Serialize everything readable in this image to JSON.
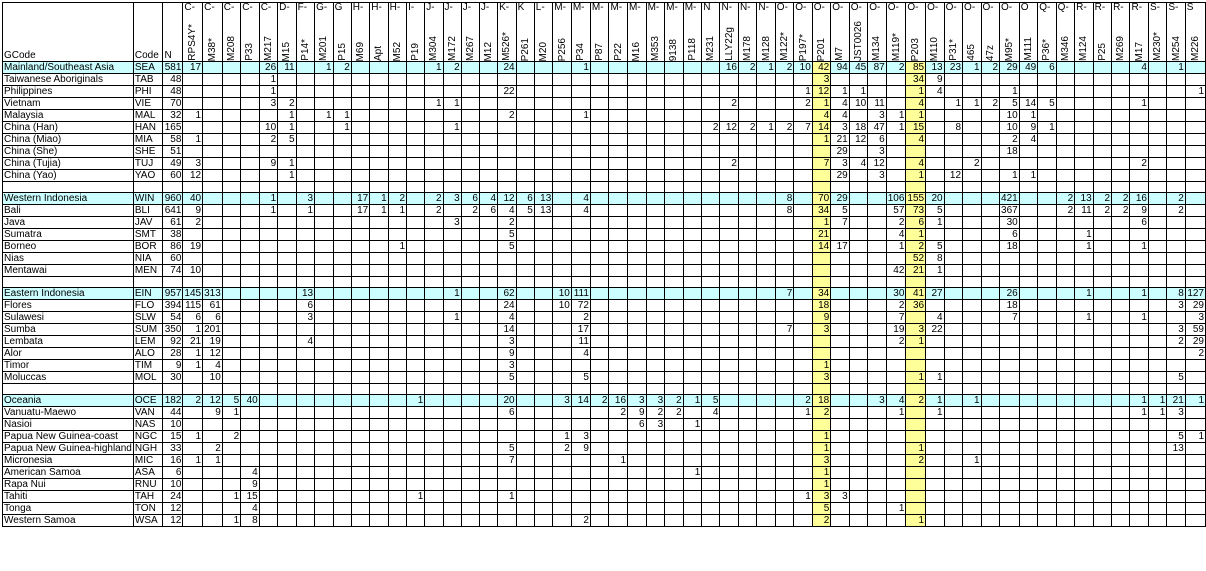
{
  "headers": {
    "gcode": "GCode",
    "code": "Code",
    "n": "N"
  },
  "columns": [
    {
      "hap": "C-",
      "marker": "RPS4Y*"
    },
    {
      "hap": "C-",
      "marker": "M38*"
    },
    {
      "hap": "C-",
      "marker": "M208"
    },
    {
      "hap": "C-",
      "marker": "P33"
    },
    {
      "hap": "C-",
      "marker": "M217"
    },
    {
      "hap": "D-",
      "marker": "M15"
    },
    {
      "hap": "F-",
      "marker": "P14*"
    },
    {
      "hap": "G-",
      "marker": "M201"
    },
    {
      "hap": "G",
      "marker": "P15"
    },
    {
      "hap": "H-",
      "marker": "M69"
    },
    {
      "hap": "H-",
      "marker": "Apt"
    },
    {
      "hap": "H-",
      "marker": "M52"
    },
    {
      "hap": "I-",
      "marker": "P19"
    },
    {
      "hap": "J-",
      "marker": "M304"
    },
    {
      "hap": "J-",
      "marker": "M172"
    },
    {
      "hap": "J-",
      "marker": "M267"
    },
    {
      "hap": "J-",
      "marker": "M12"
    },
    {
      "hap": "K-",
      "marker": "M526*"
    },
    {
      "hap": "K",
      "marker": "P261"
    },
    {
      "hap": "L-",
      "marker": "M20"
    },
    {
      "hap": "M-",
      "marker": "P256"
    },
    {
      "hap": "M-",
      "marker": "P34"
    },
    {
      "hap": "M-",
      "marker": "P87"
    },
    {
      "hap": "M-",
      "marker": "P22"
    },
    {
      "hap": "M-",
      "marker": "M16"
    },
    {
      "hap": "M-",
      "marker": "M353"
    },
    {
      "hap": "M-",
      "marker": "9138"
    },
    {
      "hap": "M-",
      "marker": "P118"
    },
    {
      "hap": "N",
      "marker": "M231"
    },
    {
      "hap": "N-",
      "marker": "LLY22g"
    },
    {
      "hap": "N-",
      "marker": "M178"
    },
    {
      "hap": "N-",
      "marker": "M128"
    },
    {
      "hap": "O-",
      "marker": "M122*"
    },
    {
      "hap": "O-",
      "marker": "P197*"
    },
    {
      "hap": "O-",
      "marker": "P201"
    },
    {
      "hap": "O-",
      "marker": "M7"
    },
    {
      "hap": "O-",
      "marker": "JST0026"
    },
    {
      "hap": "O-",
      "marker": "M134"
    },
    {
      "hap": "O-",
      "marker": "M119*"
    },
    {
      "hap": "O-",
      "marker": "P203"
    },
    {
      "hap": "O-",
      "marker": "M110"
    },
    {
      "hap": "O-",
      "marker": "P31*"
    },
    {
      "hap": "O-",
      "marker": "465"
    },
    {
      "hap": "O-",
      "marker": "47z"
    },
    {
      "hap": "O-",
      "marker": "M95*"
    },
    {
      "hap": "O",
      "marker": "M111"
    },
    {
      "hap": "Q-",
      "marker": "P36*"
    },
    {
      "hap": "Q-",
      "marker": "M346"
    },
    {
      "hap": "R-",
      "marker": "M124"
    },
    {
      "hap": "R-",
      "marker": "P25"
    },
    {
      "hap": "R-",
      "marker": "M269"
    },
    {
      "hap": "R-",
      "marker": "M17"
    },
    {
      "hap": "S-",
      "marker": "M230*"
    },
    {
      "hap": "S-",
      "marker": "M254"
    },
    {
      "hap": "S",
      "marker": "M226"
    }
  ],
  "rows": [
    {
      "t": "sum",
      "g": "Mainland/Southeast Asia",
      "c": "SEA",
      "n": "581",
      "v": {
        "0": "17",
        "4": "26",
        "5": "11",
        "7": "1",
        "8": "2",
        "13": "1",
        "14": "2",
        "17": "24",
        "21": "1",
        "29": "16",
        "30": "2",
        "31": "1",
        "32": "2",
        "33": "10",
        "34": "42",
        "35": "94",
        "36": "45",
        "37": "87",
        "38": "2",
        "39": "85",
        "40": "13",
        "41": "23",
        "42": "1",
        "43": "2",
        "44": "29",
        "45": "49",
        "46": "6",
        "51": "4",
        "53": "1"
      }
    },
    {
      "t": "r",
      "g": "Taiwanese Aboriginals",
      "c": "TAB",
      "n": "48",
      "v": {
        "4": "1",
        "34": "3",
        "39": "34",
        "40": "9"
      }
    },
    {
      "t": "r",
      "g": "Philippines",
      "c": "PHI",
      "n": "48",
      "v": {
        "4": "1",
        "17": "22",
        "33": "1",
        "34": "12",
        "35": "1",
        "36": "1",
        "39": "1",
        "40": "4",
        "44": "1",
        "54": "1"
      }
    },
    {
      "t": "r",
      "g": "Vietnam",
      "c": "VIE",
      "n": "70",
      "v": {
        "4": "3",
        "5": "2",
        "13": "1",
        "14": "1",
        "29": "2",
        "33": "2",
        "34": "1",
        "35": "4",
        "36": "10",
        "37": "11",
        "39": "4",
        "41": "1",
        "42": "1",
        "43": "2",
        "44": "5",
        "45": "14",
        "46": "5",
        "51": "1"
      }
    },
    {
      "t": "r",
      "g": "Malaysia",
      "c": "MAL",
      "n": "32",
      "v": {
        "0": "1",
        "5": "1",
        "7": "1",
        "8": "1",
        "17": "2",
        "21": "1",
        "34": "4",
        "35": "4",
        "37": "3",
        "38": "1",
        "39": "1",
        "44": "10",
        "45": "1"
      }
    },
    {
      "t": "r",
      "g": "China (Han)",
      "c": "HAN",
      "n": "165",
      "v": {
        "4": "10",
        "5": "1",
        "8": "1",
        "14": "1",
        "28": "2",
        "29": "12",
        "30": "2",
        "31": "1",
        "32": "2",
        "33": "7",
        "34": "14",
        "35": "3",
        "36": "18",
        "37": "47",
        "38": "1",
        "39": "15",
        "41": "8",
        "44": "10",
        "45": "9",
        "46": "1"
      }
    },
    {
      "t": "r",
      "g": "China (Miao)",
      "c": "MIA",
      "n": "58",
      "v": {
        "0": "1",
        "4": "2",
        "5": "5",
        "34": "1",
        "35": "21",
        "36": "12",
        "37": "6",
        "39": "4",
        "44": "2",
        "45": "4"
      }
    },
    {
      "t": "r",
      "g": "China (She)",
      "c": "SHE",
      "n": "51",
      "v": {
        "35": "29",
        "37": "3",
        "44": "18"
      }
    },
    {
      "t": "r",
      "g": "China (Tujia)",
      "c": "TUJ",
      "n": "49",
      "v": {
        "0": "3",
        "4": "9",
        "5": "1",
        "29": "2",
        "34": "7",
        "35": "3",
        "36": "4",
        "37": "12",
        "39": "4",
        "42": "2",
        "51": "2"
      }
    },
    {
      "t": "r",
      "g": "China (Yao)",
      "c": "YAO",
      "n": "60",
      "v": {
        "0": "12",
        "5": "1",
        "35": "29",
        "37": "3",
        "39": "1",
        "41": "12",
        "44": "1",
        "45": "1"
      }
    },
    {
      "t": "gap"
    },
    {
      "t": "sum",
      "g": "Western Indonesia",
      "c": "WIN",
      "n": "960",
      "v": {
        "0": "40",
        "4": "1",
        "6": "3",
        "9": "17",
        "10": "1",
        "11": "2",
        "13": "2",
        "14": "3",
        "15": "6",
        "16": "4",
        "17": "12",
        "18": "6",
        "19": "13",
        "21": "4",
        "32": "8",
        "34": "70",
        "35": "29",
        "38": "106",
        "39": "155",
        "40": "20",
        "44": "421",
        "47": "2",
        "48": "13",
        "49": "2",
        "50": "2",
        "51": "16",
        "53": "2"
      }
    },
    {
      "t": "r",
      "g": "Bali",
      "c": "BLI",
      "n": "641",
      "v": {
        "0": "9",
        "4": "1",
        "6": "1",
        "9": "17",
        "10": "1",
        "11": "1",
        "13": "2",
        "15": "2",
        "16": "6",
        "17": "4",
        "18": "5",
        "19": "13",
        "21": "4",
        "32": "8",
        "34": "34",
        "35": "5",
        "38": "57",
        "39": "73",
        "40": "5",
        "44": "367",
        "47": "2",
        "48": "11",
        "49": "2",
        "50": "2",
        "51": "9",
        "53": "2"
      }
    },
    {
      "t": "r",
      "g": "Java",
      "c": "JAV",
      "n": "61",
      "v": {
        "0": "2",
        "14": "3",
        "17": "2",
        "34": "1",
        "35": "7",
        "38": "2",
        "39": "6",
        "40": "1",
        "44": "30",
        "51": "6"
      }
    },
    {
      "t": "r",
      "g": "Sumatra",
      "c": "SMT",
      "n": "38",
      "v": {
        "17": "5",
        "34": "21",
        "38": "4",
        "39": "1",
        "44": "6",
        "48": "1"
      }
    },
    {
      "t": "r",
      "g": "Borneo",
      "c": "BOR",
      "n": "86",
      "v": {
        "0": "19",
        "11": "1",
        "17": "5",
        "34": "14",
        "35": "17",
        "38": "1",
        "39": "2",
        "40": "5",
        "44": "18",
        "48": "1",
        "51": "1"
      }
    },
    {
      "t": "r",
      "g": "Nias",
      "c": "NIA",
      "n": "60",
      "v": {
        "39": "52",
        "40": "8"
      }
    },
    {
      "t": "r",
      "g": "Mentawai",
      "c": "MEN",
      "n": "74",
      "v": {
        "0": "10",
        "38": "42",
        "39": "21",
        "40": "1"
      }
    },
    {
      "t": "gap"
    },
    {
      "t": "sum",
      "g": "Eastern Indonesia",
      "c": "EIN",
      "n": "957",
      "v": {
        "0": "145",
        "1": "313",
        "6": "13",
        "14": "1",
        "17": "62",
        "20": "10",
        "21": "111",
        "32": "7",
        "34": "34",
        "38": "30",
        "39": "41",
        "40": "27",
        "44": "26",
        "48": "1",
        "51": "1",
        "53": "8",
        "54": "127"
      }
    },
    {
      "t": "r",
      "g": "Flores",
      "c": "FLO",
      "n": "394",
      "v": {
        "0": "115",
        "1": "61",
        "6": "6",
        "17": "24",
        "20": "10",
        "21": "72",
        "34": "18",
        "38": "2",
        "39": "36",
        "44": "18",
        "53": "3",
        "54": "29"
      }
    },
    {
      "t": "r",
      "g": "Sulawesi",
      "c": "SLW",
      "n": "54",
      "v": {
        "0": "6",
        "1": "6",
        "6": "3",
        "14": "1",
        "17": "4",
        "21": "2",
        "34": "9",
        "38": "7",
        "40": "4",
        "44": "7",
        "48": "1",
        "51": "1",
        "54": "3"
      }
    },
    {
      "t": "r",
      "g": "Sumba",
      "c": "SUM",
      "n": "350",
      "v": {
        "0": "1",
        "1": "201",
        "17": "14",
        "21": "17",
        "32": "7",
        "34": "3",
        "38": "19",
        "39": "3",
        "40": "22",
        "53": "3",
        "54": "59"
      }
    },
    {
      "t": "r",
      "g": "Lembata",
      "c": "LEM",
      "n": "92",
      "v": {
        "0": "21",
        "1": "19",
        "6": "4",
        "17": "3",
        "21": "11",
        "38": "2",
        "39": "1",
        "53": "2",
        "54": "29"
      }
    },
    {
      "t": "r",
      "g": "Alor",
      "c": "ALO",
      "n": "28",
      "v": {
        "0": "1",
        "1": "12",
        "17": "9",
        "21": "4",
        "54": "2"
      }
    },
    {
      "t": "r",
      "g": "Timor",
      "c": "TIM",
      "n": "9",
      "v": {
        "0": "1",
        "1": "4",
        "17": "3",
        "34": "1"
      }
    },
    {
      "t": "r",
      "g": "Moluccas",
      "c": "MOL",
      "n": "30",
      "v": {
        "1": "10",
        "17": "5",
        "21": "5",
        "34": "3",
        "39": "1",
        "40": "1",
        "53": "5"
      }
    },
    {
      "t": "gap"
    },
    {
      "t": "sum",
      "g": "Oceania",
      "c": "OCE",
      "n": "182",
      "v": {
        "0": "2",
        "1": "12",
        "2": "5",
        "3": "40",
        "12": "1",
        "17": "20",
        "20": "3",
        "21": "14",
        "22": "2",
        "23": "16",
        "24": "3",
        "25": "3",
        "26": "2",
        "27": "1",
        "28": "5",
        "33": "2",
        "34": "18",
        "37": "3",
        "38": "4",
        "39": "2",
        "40": "1",
        "42": "1",
        "51": "1",
        "52": "1",
        "53": "21",
        "54": "1"
      }
    },
    {
      "t": "r",
      "g": "Vanuatu-Maewo",
      "c": "VAN",
      "n": "44",
      "v": {
        "1": "9",
        "2": "1",
        "17": "6",
        "23": "2",
        "24": "9",
        "25": "2",
        "26": "2",
        "28": "4",
        "33": "1",
        "34": "2",
        "38": "1",
        "40": "1",
        "51": "1",
        "52": "1",
        "53": "3"
      }
    },
    {
      "t": "r",
      "g": "Nasioi",
      "c": "NAS",
      "n": "10",
      "v": {
        "24": "6",
        "25": "3",
        "27": "1"
      }
    },
    {
      "t": "r",
      "g": "Papua New Guinea-coast",
      "c": "NGC",
      "n": "15",
      "v": {
        "0": "1",
        "2": "2",
        "20": "1",
        "21": "3",
        "34": "1",
        "53": "5",
        "54": "1"
      }
    },
    {
      "t": "r",
      "g": "Papua New Guinea-highland",
      "c": "NGH",
      "n": "33",
      "v": {
        "1": "2",
        "17": "5",
        "20": "2",
        "21": "9",
        "34": "1",
        "39": "1",
        "53": "13"
      }
    },
    {
      "t": "r",
      "g": "Micronesia",
      "c": "MIC",
      "n": "16",
      "v": {
        "0": "1",
        "1": "1",
        "17": "7",
        "23": "1",
        "34": "3",
        "39": "2",
        "42": "1"
      }
    },
    {
      "t": "r",
      "g": "American Samoa",
      "c": "ASA",
      "n": "6",
      "v": {
        "3": "4",
        "27": "1",
        "34": "1"
      }
    },
    {
      "t": "r",
      "g": "Rapa Nui",
      "c": "RNU",
      "n": "10",
      "v": {
        "3": "9",
        "34": "1"
      }
    },
    {
      "t": "r",
      "g": "Tahiti",
      "c": "TAH",
      "n": "24",
      "v": {
        "2": "1",
        "3": "15",
        "12": "1",
        "17": "1",
        "33": "1",
        "34": "3",
        "35": "3"
      }
    },
    {
      "t": "r",
      "g": "Tonga",
      "c": "TON",
      "n": "12",
      "v": {
        "3": "4",
        "34": "5",
        "38": "1"
      }
    },
    {
      "t": "r",
      "g": "Western Samoa",
      "c": "WSA",
      "n": "12",
      "v": {
        "2": "1",
        "3": "8",
        "21": "2",
        "34": "2",
        "39": "1"
      }
    }
  ]
}
